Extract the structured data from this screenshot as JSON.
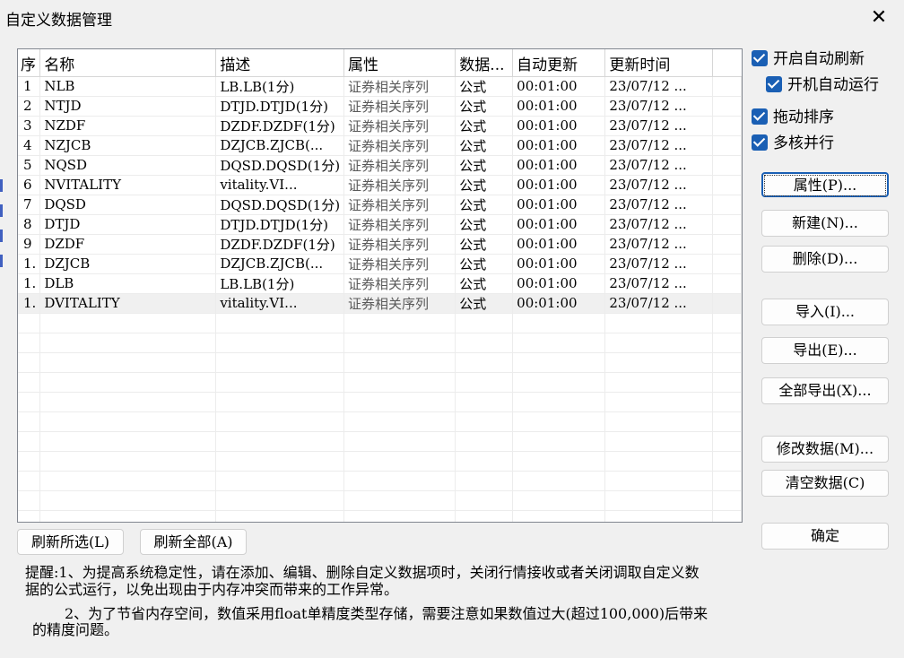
{
  "window": {
    "title": "自定义数据管理",
    "close_icon": "✕"
  },
  "table": {
    "columns": [
      "序",
      "名称",
      "描述",
      "属性",
      "数据...",
      "自动更新",
      "更新时间"
    ],
    "rows": [
      [
        "1",
        "NLB",
        "LB.LB(1分)",
        "证券相关序列",
        "公式",
        "00:01:00",
        "23/07/12 ..."
      ],
      [
        "2",
        "NTJD",
        "DTJD.DTJD(1分)",
        "证券相关序列",
        "公式",
        "00:01:00",
        "23/07/12 ..."
      ],
      [
        "3",
        "NZDF",
        "DZDF.DZDF(1分)",
        "证券相关序列",
        "公式",
        "00:01:00",
        "23/07/12 ..."
      ],
      [
        "4",
        "NZJCB",
        "DZJCB.ZJCB(...",
        "证券相关序列",
        "公式",
        "00:01:00",
        "23/07/12 ..."
      ],
      [
        "5",
        "NQSD",
        "DQSD.DQSD(1分)",
        "证券相关序列",
        "公式",
        "00:01:00",
        "23/07/12 ..."
      ],
      [
        "6",
        "NVITALITY",
        "vitality.VI...",
        "证券相关序列",
        "公式",
        "00:01:00",
        "23/07/12 ..."
      ],
      [
        "7",
        "DQSD",
        "DQSD.DQSD(1分)",
        "证券相关序列",
        "公式",
        "00:01:00",
        "23/07/12 ..."
      ],
      [
        "8",
        "DTJD",
        "DTJD.DTJD(1分)",
        "证券相关序列",
        "公式",
        "00:01:00",
        "23/07/12 ..."
      ],
      [
        "9",
        "DZDF",
        "DZDF.DZDF(1分)",
        "证券相关序列",
        "公式",
        "00:01:00",
        "23/07/12 ..."
      ],
      [
        "1.",
        "DZJCB",
        "DZJCB.ZJCB(...",
        "证券相关序列",
        "公式",
        "00:01:00",
        "23/07/12 ..."
      ],
      [
        "1.",
        "DLB",
        "LB.LB(1分)",
        "证券相关序列",
        "公式",
        "00:01:00",
        "23/07/12 ..."
      ],
      [
        "1.",
        "DVITALITY",
        "vitality.VI...",
        "证券相关序列",
        "公式",
        "00:01:00",
        "23/07/12 ..."
      ]
    ]
  },
  "options": {
    "auto_refresh": "开启自动刷新",
    "startup_auto_run": "开机自动运行",
    "drag_sort": "拖动排序",
    "multicore": "多核并行"
  },
  "buttons": {
    "properties": "属性(P)...",
    "new": "新建(N)...",
    "delete": "删除(D)...",
    "import": "导入(I)...",
    "export": "导出(E)...",
    "export_all": "全部导出(X)...",
    "modify_data": "修改数据(M)...",
    "clear_data": "清空数据(C)",
    "ok": "确定",
    "refresh_selected": "刷新所选(L)",
    "refresh_all": "刷新全部(A)"
  },
  "notes": {
    "line1": "提醒:1、为提高系统稳定性，请在添加、编辑、删除自定义数据项时，关闭行情接收或者关闭调取自定义数",
    "line2": "据的公式运行，以免出现由于内存冲突而带来的工作异常。",
    "line3": "2、为了节省内存空间，数值采用float单精度类型存储，需要注意如果数值过大(超过100,000)后带来",
    "line4": "的精度问题。"
  }
}
